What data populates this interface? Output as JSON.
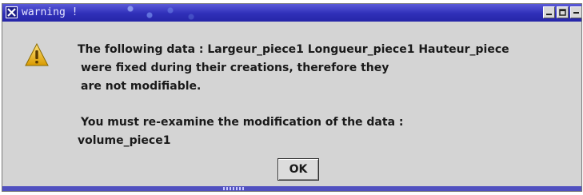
{
  "window": {
    "title": "warning !"
  },
  "dialog": {
    "message_lines": [
      "The following data :  Largeur_piece1 Longueur_piece1 Hauteur_piece",
      "were fixed during their creations, therefore they",
      "are not modifiable.",
      "You must re-examine the modification of the data :",
      "volume_piece1"
    ],
    "ok_label": "OK"
  },
  "colors": {
    "titlebar": "#2f2fb8",
    "window_bg": "#d4d4d4",
    "warning_icon": "#e8b000"
  },
  "icons": {
    "close": "close-x-icon",
    "minimize": "minimize-icon",
    "maximize": "maximize-icon",
    "warning": "warning-triangle-icon"
  }
}
